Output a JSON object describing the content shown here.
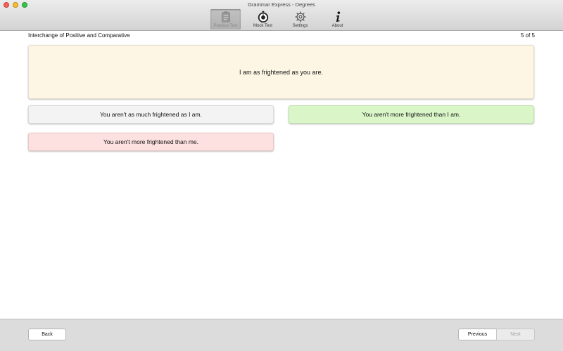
{
  "window": {
    "title": "Grammar Express - Degrees"
  },
  "toolbar": {
    "items": [
      {
        "label": "Practice Test",
        "icon": "clipboard-icon",
        "active": true
      },
      {
        "label": "Mock Test",
        "icon": "stopwatch-icon",
        "active": false
      },
      {
        "label": "Settings",
        "icon": "gear-icon",
        "active": false
      },
      {
        "label": "About",
        "icon": "info-icon",
        "active": false
      }
    ]
  },
  "header": {
    "section_title": "Interchange of Positive and Comparative",
    "progress": "5 of 5"
  },
  "question": {
    "text": "I am as frightened as you are."
  },
  "options": [
    {
      "text": "You aren't as much frightened as I am.",
      "state": "neutral",
      "color": "#f3f3f3"
    },
    {
      "text": "You aren't more frightened than I am.",
      "state": "correct",
      "color": "#daf6c8"
    },
    {
      "text": "You aren't more frightened than me.",
      "state": "wrong",
      "color": "#fde0e0"
    }
  ],
  "footer": {
    "back_label": "Back",
    "previous_label": "Previous",
    "next_label": "Next",
    "next_enabled": false
  }
}
